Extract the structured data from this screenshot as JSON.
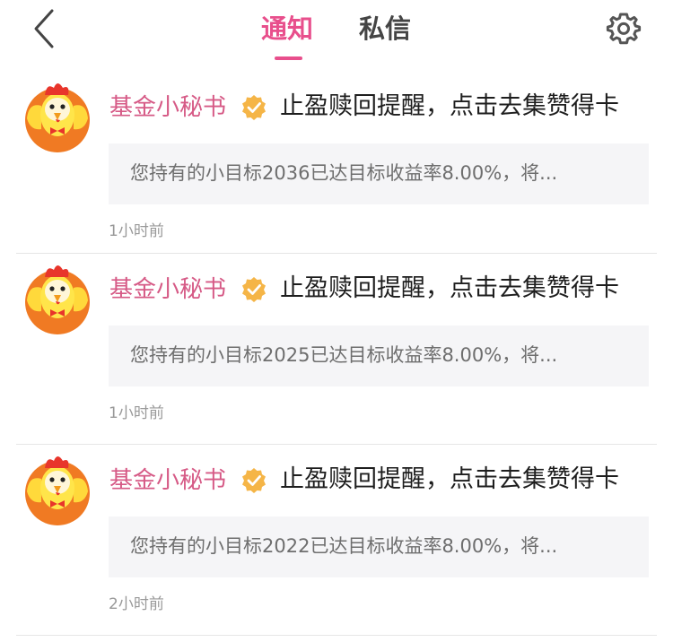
{
  "header": {
    "tabs": [
      {
        "label": "通知",
        "active": true
      },
      {
        "label": "私信",
        "active": false
      }
    ],
    "back_icon": "chevron-left-icon",
    "settings_icon": "gear-icon"
  },
  "colors": {
    "accent": "#e84f8c",
    "sender_name": "#d65a86",
    "verified_badge": "#f5b547",
    "preview_bg": "#f5f5f7"
  },
  "notices": [
    {
      "sender": "基金小秘书",
      "title": "止盈赎回提醒，点击去集赞得卡",
      "preview": "您持有的小目标2036已达目标收益率8.00%，将...",
      "time": "1小时前"
    },
    {
      "sender": "基金小秘书",
      "title": "止盈赎回提醒，点击去集赞得卡",
      "preview": "您持有的小目标2025已达目标收益率8.00%，将...",
      "time": "1小时前"
    },
    {
      "sender": "基金小秘书",
      "title": "止盈赎回提醒，点击去集赞得卡",
      "preview": "您持有的小目标2022已达目标收益率8.00%，将...",
      "time": "2小时前"
    }
  ]
}
